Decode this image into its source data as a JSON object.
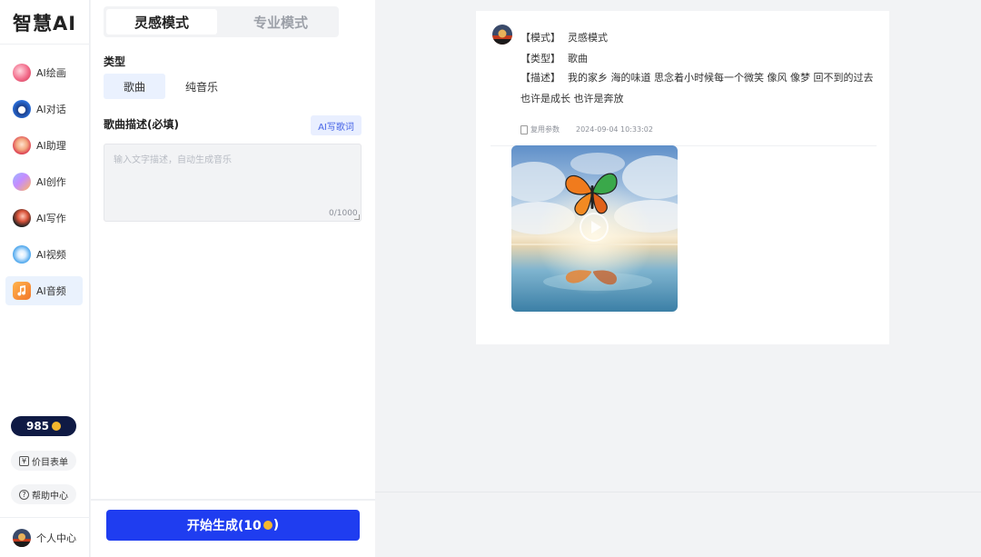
{
  "app": {
    "logo": "智慧AI"
  },
  "nav": {
    "items": [
      {
        "label": "AI绘画"
      },
      {
        "label": "AI对话"
      },
      {
        "label": "AI助理"
      },
      {
        "label": "AI创作"
      },
      {
        "label": "AI写作"
      },
      {
        "label": "AI视频"
      },
      {
        "label": "AI音频",
        "active": true
      }
    ],
    "coins": "985",
    "price_list": "价目表单",
    "help": "帮助中心",
    "profile": "个人中心"
  },
  "panel": {
    "tabs": [
      {
        "label": "灵感模式",
        "active": true
      },
      {
        "label": "专业模式"
      }
    ],
    "type_label": "类型",
    "types": [
      {
        "label": "歌曲",
        "active": true
      },
      {
        "label": "纯音乐"
      }
    ],
    "desc_label": "歌曲描述(必填)",
    "ai_lyrics_button": "AI写歌词",
    "desc_placeholder": "输入文字描述，自动生成音乐",
    "desc_value": "",
    "counter": "0/1000",
    "generate_label": "开始生成(10",
    "generate_suffix": ")"
  },
  "result": {
    "mode_key": "【模式】",
    "mode_value": "灵感模式",
    "type_key": "【类型】",
    "type_value": "歌曲",
    "desc_key": "【描述】",
    "desc_value": "我的家乡 海的味道 思念着小时候每一个微笑 像风 像梦 回不到的过去 也许是成长 也许是奔放",
    "reuse_label": "复用参数",
    "timestamp": "2024-09-04 10:33:02"
  },
  "colors": {
    "accent": "#1f3df0",
    "active_bg": "#eaf2fd",
    "coin": "#f5b72d"
  }
}
